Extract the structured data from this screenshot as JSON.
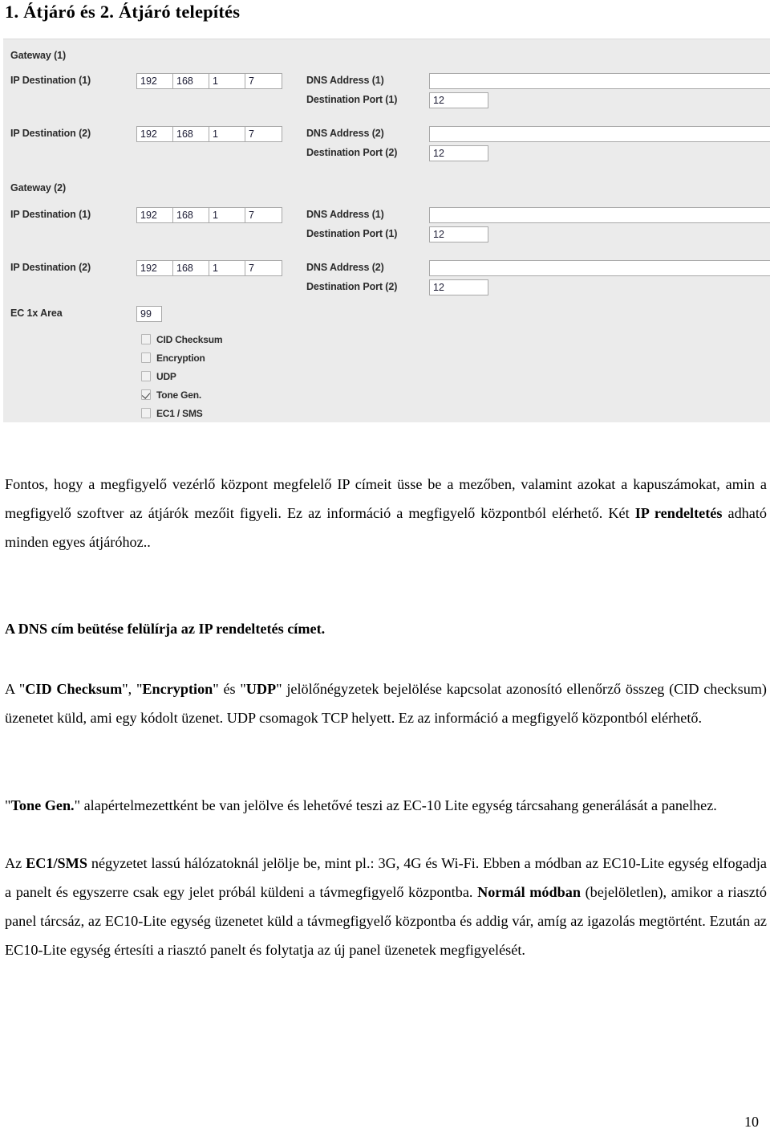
{
  "document": {
    "heading": "1. Átjáró és 2. Átjáró telepítés",
    "page_number": "10"
  },
  "screenshot": {
    "panel_bg": "#ebebeb",
    "groups": [
      {
        "title": "Gateway  (1)",
        "rows": [
          {
            "ip_label": "IP Destination  (1)",
            "octets": [
              "192",
              "168",
              "1",
              "7"
            ],
            "dns_label": "DNS Address (1)",
            "dns_value": "",
            "port_label": "Destination Port (1)",
            "port_value": "12"
          },
          {
            "ip_label": "IP Destination  (2)",
            "octets": [
              "192",
              "168",
              "1",
              "7"
            ],
            "dns_label": "DNS Address (2)",
            "dns_value": "",
            "port_label": "Destination Port (2)",
            "port_value": "12"
          }
        ]
      },
      {
        "title": "Gateway  (2)",
        "rows": [
          {
            "ip_label": "IP Destination  (1)",
            "octets": [
              "192",
              "168",
              "1",
              "7"
            ],
            "dns_label": "DNS Address (1)",
            "dns_value": "",
            "port_label": "Destination Port (1)",
            "port_value": "12"
          },
          {
            "ip_label": "IP Destination  (2)",
            "octets": [
              "192",
              "168",
              "1",
              "7"
            ],
            "dns_label": "DNS Address (2)",
            "dns_value": "",
            "port_label": "Destination Port (2)",
            "port_value": "12"
          }
        ]
      }
    ],
    "ec_area": {
      "label": "EC 1x Area",
      "value": "99"
    },
    "checkboxes": [
      {
        "label": "CID Checksum",
        "checked": false
      },
      {
        "label": "Encryption",
        "checked": false
      },
      {
        "label": "UDP",
        "checked": false
      },
      {
        "label": "Tone Gen.",
        "checked": true
      },
      {
        "label": "EC1 / SMS",
        "checked": false
      }
    ]
  },
  "paragraphs": {
    "p1_a": "Fontos, hogy a megfigyelő vezérlő központ megfelelő IP címeit üsse be a mezőben, valamint azokat a kapuszámokat, amin a megfigyelő szoftver az átjárók mezőit figyeli. Ez az információ a megfigyelő központból elérhető. Két ",
    "p1_b": "IP rendeltetés",
    "p1_c": " adható minden egyes átjáróhoz..",
    "p2": "A DNS cím beütése felülírja az IP rendeltetés címet.",
    "p3_a": "A \"",
    "p3_b": "CID Checksum",
    "p3_c": "\", \"",
    "p3_d": "Encryption",
    "p3_e": "\" és \"",
    "p3_f": "UDP",
    "p3_g": "\" jelölőnégyzetek bejelölése kapcsolat azonosító ellenőrző összeg (CID checksum) üzenetet küld, ami egy kódolt üzenet. UDP csomagok TCP helyett. Ez az információ a megfigyelő központból elérhető.",
    "p4_a": "\"",
    "p4_b": "Tone Gen.",
    "p4_c": "\" alapértelmezettként be van jelölve és lehetővé teszi az EC-10 Lite egység tárcsahang generálását a panelhez.",
    "p5_a": "Az ",
    "p5_b": "EC1/SMS",
    "p5_c": " négyzetet lassú hálózatoknál jelölje be, mint pl.: 3G, 4G és Wi-Fi. Ebben a módban az EC10-Lite egység elfogadja a panelt és egyszerre csak egy jelet próbál küldeni a távmegfigyelő központba.  ",
    "p5_d": "Normál módban",
    "p5_e": " (bejelöletlen), amikor a riasztó panel tárcsáz, az EC10-Lite egység üzenetet küld a távmegfigyelő központba és addig vár, amíg az igazolás megtörtént. Ezután az EC10-Lite egység értesíti a riasztó panelt és folytatja az új panel üzenetek megfigyelését."
  }
}
